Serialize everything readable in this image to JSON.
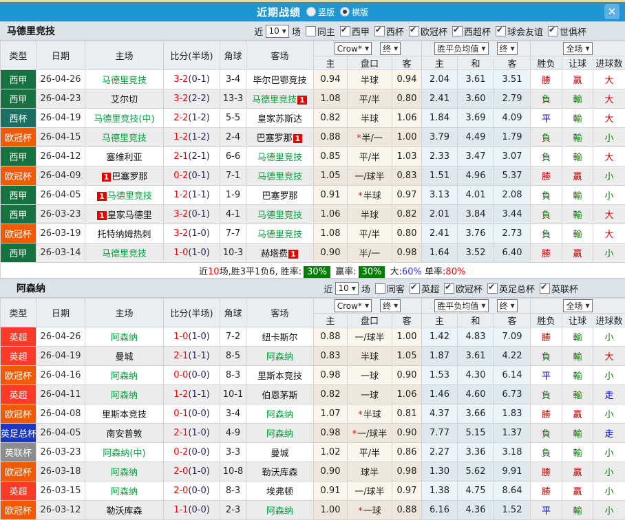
{
  "titlebar": {
    "title": "近期战绩",
    "vertical_label": "竖版",
    "horizontal_label": "横版"
  },
  "card_label": "1",
  "league_colors": {
    "西甲": "#177241",
    "西杯": "#1c6f63",
    "欧冠杯": "#f25a02",
    "英超": "#fb3a28",
    "英足总杯": "#1c38c0",
    "英联杯": "#8d8d8d"
  },
  "result_colors": {
    "r": "#cc0000",
    "g": "#008000",
    "b": "#0000cc"
  },
  "headers": {
    "type": "类型",
    "date": "日期",
    "home": "主场",
    "score": "比分(半场)",
    "corner": "角球",
    "away": "客场",
    "crown_home": "主",
    "crown_handicap": "盘口",
    "crown_away": "客",
    "euro_home": "主",
    "euro_draw": "和",
    "euro_away": "客",
    "res_wdl": "胜负",
    "res_handicap": "让球",
    "res_goals": "进球数"
  },
  "tables": [
    {
      "team": "马德里竞技",
      "filters": {
        "near": "近",
        "count": "10",
        "games": "场",
        "same": "同主",
        "leagues": [
          "西甲",
          "西杯",
          "欧冠杯",
          "西超杯",
          "球会友谊",
          "世俱杯"
        ]
      },
      "dropdowns": {
        "book": "Crow*",
        "final_a": "终",
        "avg": "胜平负均值",
        "final_b": "终",
        "scope": "全场"
      },
      "rows": [
        {
          "type": "西甲",
          "date": "26-04-26",
          "home": "马德里竞技",
          "home_hl": true,
          "score": "3-2",
          "half": "(0-1)",
          "corner": "3-4",
          "away": "毕尔巴鄂竞技",
          "c1": "0.94",
          "hc": "半球",
          "c2": "0.94",
          "e1": "2.04",
          "e2": "3.61",
          "e3": "3.51",
          "r1": "勝",
          "r1c": "r",
          "r2": "贏",
          "r2c": "r",
          "r3": "大",
          "r3c": "r"
        },
        {
          "type": "西甲",
          "date": "26-04-23",
          "home": "艾尔切",
          "score": "3-2",
          "half": "(2-2)",
          "corner": "13-3",
          "away": "马德里竞技",
          "away_hl": true,
          "away_card": "trail",
          "c1": "1.08",
          "hc": "平/半",
          "c2": "0.80",
          "e1": "2.41",
          "e2": "3.60",
          "e3": "2.79",
          "r1": "負",
          "r1c": "g",
          "r2": "輸",
          "r2c": "g",
          "r3": "大",
          "r3c": "r"
        },
        {
          "type": "西杯",
          "date": "26-04-19",
          "home": "马德里竞技(中)",
          "home_hl": true,
          "score": "2-2",
          "half": "(1-2)",
          "corner": "5-5",
          "away": "皇家苏斯达",
          "c1": "0.82",
          "hc": "半球",
          "c2": "1.06",
          "e1": "1.84",
          "e2": "3.69",
          "e3": "4.09",
          "r1": "平",
          "r1c": "b",
          "r2": "輸",
          "r2c": "g",
          "r3": "大",
          "r3c": "r"
        },
        {
          "type": "欧冠杯",
          "date": "26-04-15",
          "home": "马德里竞技",
          "home_hl": true,
          "score": "1-2",
          "half": "(1-2)",
          "corner": "2-4",
          "away": "巴塞罗那",
          "away_card": "trail",
          "c1": "0.88",
          "hc": "半/一",
          "hc_star": true,
          "c2": "1.00",
          "e1": "3.79",
          "e2": "4.49",
          "e3": "1.79",
          "r1": "負",
          "r1c": "g",
          "r2": "輸",
          "r2c": "g",
          "r3": "小",
          "r3c": "g"
        },
        {
          "type": "西甲",
          "date": "26-04-12",
          "home": "塞维利亚",
          "score": "2-1",
          "half": "(2-1)",
          "corner": "6-6",
          "away": "马德里竞技",
          "away_hl": true,
          "c1": "0.85",
          "hc": "平/半",
          "c2": "1.03",
          "e1": "2.33",
          "e2": "3.47",
          "e3": "3.07",
          "r1": "負",
          "r1c": "g",
          "r2": "輸",
          "r2c": "g",
          "r3": "大",
          "r3c": "r"
        },
        {
          "type": "欧冠杯",
          "date": "26-04-09",
          "home": "巴塞罗那",
          "home_card": "lead",
          "score": "0-2",
          "half": "(0-1)",
          "corner": "7-1",
          "away": "马德里竞技",
          "away_hl": true,
          "c1": "1.05",
          "hc": "一/球半",
          "c2": "0.83",
          "e1": "1.51",
          "e2": "4.96",
          "e3": "5.37",
          "r1": "勝",
          "r1c": "r",
          "r2": "贏",
          "r2c": "r",
          "r3": "小",
          "r3c": "g"
        },
        {
          "type": "西甲",
          "date": "26-04-05",
          "home": "马德里竞技",
          "home_hl": true,
          "home_card": "lead",
          "score": "1-2",
          "half": "(1-1)",
          "corner": "1-9",
          "away": "巴塞罗那",
          "c1": "0.91",
          "hc": "半球",
          "hc_star": true,
          "c2": "0.97",
          "e1": "3.13",
          "e2": "4.01",
          "e3": "2.08",
          "r1": "負",
          "r1c": "g",
          "r2": "輸",
          "r2c": "g",
          "r3": "小",
          "r3c": "g"
        },
        {
          "type": "西甲",
          "date": "26-03-23",
          "home": "皇家马德里",
          "home_card": "lead",
          "score": "3-2",
          "half": "(0-1)",
          "corner": "4-1",
          "away": "马德里竞技",
          "away_hl": true,
          "c1": "1.06",
          "hc": "半球",
          "c2": "0.82",
          "e1": "2.01",
          "e2": "3.84",
          "e3": "3.44",
          "r1": "負",
          "r1c": "g",
          "r2": "輸",
          "r2c": "g",
          "r3": "大",
          "r3c": "r"
        },
        {
          "type": "欧冠杯",
          "date": "26-03-19",
          "home": "托特纳姆热刺",
          "score": "3-2",
          "half": "(1-0)",
          "corner": "7-7",
          "away": "马德里竞技",
          "away_hl": true,
          "c1": "1.08",
          "hc": "平/半",
          "c2": "0.80",
          "e1": "2.41",
          "e2": "3.76",
          "e3": "2.73",
          "r1": "負",
          "r1c": "g",
          "r2": "輸",
          "r2c": "g",
          "r3": "大",
          "r3c": "r"
        },
        {
          "type": "西甲",
          "date": "26-03-14",
          "home": "马德里竞技",
          "home_hl": true,
          "score": "1-0",
          "half": "(1-0)",
          "corner": "10-3",
          "away": "赫塔费",
          "away_card": "trail",
          "c1": "0.90",
          "hc": "半/一",
          "c2": "0.98",
          "e1": "1.64",
          "e2": "3.52",
          "e3": "6.40",
          "r1": "勝",
          "r1c": "r",
          "r2": "贏",
          "r2c": "r",
          "r3": "小",
          "r3c": "g"
        }
      ],
      "summary": [
        {
          "t": "近",
          "c": "k"
        },
        {
          "t": "10",
          "c": "red"
        },
        {
          "t": "场,胜3平1负6, 胜率:",
          "c": "k"
        },
        {
          "t": "30%",
          "c": "chip"
        },
        {
          "t": " 赢率:",
          "c": "k"
        },
        {
          "t": "30%",
          "c": "chip"
        },
        {
          "t": " 大:",
          "c": "k"
        },
        {
          "t": "60%",
          "c": "blue"
        },
        {
          "t": " 单率:",
          "c": "k"
        },
        {
          "t": "80%",
          "c": "red"
        }
      ]
    },
    {
      "team": "阿森纳",
      "filters": {
        "near": "近",
        "count": "10",
        "games": "场",
        "same": "同客",
        "leagues": [
          "英超",
          "欧冠杯",
          "英足总杯",
          "英联杯"
        ]
      },
      "dropdowns": {
        "book": "Crow*",
        "final_a": "终",
        "avg": "胜平负均值",
        "final_b": "终",
        "scope": "全场"
      },
      "rows": [
        {
          "type": "英超",
          "date": "26-04-26",
          "home": "阿森纳",
          "home_hl": true,
          "score": "1-0",
          "half": "(1-0)",
          "corner": "7-2",
          "away": "纽卡斯尔",
          "c1": "0.88",
          "hc": "一/球半",
          "c2": "1.00",
          "e1": "1.42",
          "e2": "4.83",
          "e3": "7.09",
          "r1": "勝",
          "r1c": "r",
          "r2": "輸",
          "r2c": "g",
          "r3": "小",
          "r3c": "g"
        },
        {
          "type": "英超",
          "date": "26-04-19",
          "home": "曼城",
          "score": "2-1",
          "half": "(1-1)",
          "corner": "8-5",
          "away": "阿森纳",
          "away_hl": true,
          "c1": "0.83",
          "hc": "半球",
          "c2": "1.05",
          "e1": "1.87",
          "e2": "3.61",
          "e3": "4.22",
          "r1": "負",
          "r1c": "g",
          "r2": "輸",
          "r2c": "g",
          "r3": "大",
          "r3c": "r"
        },
        {
          "type": "欧冠杯",
          "date": "26-04-16",
          "home": "阿森纳",
          "home_hl": true,
          "score": "0-0",
          "half": "(0-0)",
          "corner": "8-3",
          "away": "里斯本竞技",
          "c1": "0.98",
          "hc": "一球",
          "c2": "0.90",
          "e1": "1.53",
          "e2": "4.30",
          "e3": "6.14",
          "r1": "平",
          "r1c": "b",
          "r2": "輸",
          "r2c": "g",
          "r3": "小",
          "r3c": "g"
        },
        {
          "type": "英超",
          "date": "26-04-11",
          "home": "阿森纳",
          "home_hl": true,
          "score": "1-2",
          "half": "(1-1)",
          "corner": "10-1",
          "away": "伯恩茅斯",
          "c1": "0.82",
          "hc": "一球",
          "c2": "1.06",
          "e1": "1.46",
          "e2": "4.60",
          "e3": "6.73",
          "r1": "負",
          "r1c": "g",
          "r2": "輸",
          "r2c": "g",
          "r3": "走",
          "r3c": "b"
        },
        {
          "type": "欧冠杯",
          "date": "26-04-08",
          "home": "里斯本竞技",
          "score": "0-1",
          "half": "(0-0)",
          "corner": "3-4",
          "away": "阿森纳",
          "away_hl": true,
          "c1": "1.07",
          "hc": "半球",
          "hc_star": true,
          "c2": "0.81",
          "e1": "4.37",
          "e2": "3.66",
          "e3": "1.83",
          "r1": "勝",
          "r1c": "r",
          "r2": "贏",
          "r2c": "r",
          "r3": "小",
          "r3c": "g"
        },
        {
          "type": "英足总杯",
          "date": "26-04-05",
          "home": "南安普敦",
          "score": "2-1",
          "half": "(1-0)",
          "corner": "4-9",
          "away": "阿森纳",
          "away_hl": true,
          "c1": "0.98",
          "hc": "一/球半",
          "hc_star": true,
          "c2": "0.90",
          "e1": "7.77",
          "e2": "5.15",
          "e3": "1.37",
          "r1": "負",
          "r1c": "g",
          "r2": "輸",
          "r2c": "g",
          "r3": "走",
          "r3c": "b"
        },
        {
          "type": "英联杯",
          "date": "26-03-23",
          "home": "阿森纳(中)",
          "home_hl": true,
          "score": "0-2",
          "half": "(0-0)",
          "corner": "3-3",
          "away": "曼城",
          "c1": "1.02",
          "hc": "平/半",
          "c2": "0.86",
          "e1": "2.27",
          "e2": "3.36",
          "e3": "3.18",
          "r1": "負",
          "r1c": "g",
          "r2": "輸",
          "r2c": "g",
          "r3": "小",
          "r3c": "g"
        },
        {
          "type": "欧冠杯",
          "date": "26-03-18",
          "home": "阿森纳",
          "home_hl": true,
          "score": "2-0",
          "half": "(1-0)",
          "corner": "10-8",
          "away": "勒沃库森",
          "c1": "0.90",
          "hc": "球半",
          "c2": "0.98",
          "e1": "1.30",
          "e2": "5.62",
          "e3": "9.91",
          "r1": "勝",
          "r1c": "r",
          "r2": "贏",
          "r2c": "r",
          "r3": "小",
          "r3c": "g"
        },
        {
          "type": "英超",
          "date": "26-03-15",
          "home": "阿森纳",
          "home_hl": true,
          "score": "2-0",
          "half": "(0-0)",
          "corner": "8-3",
          "away": "埃弗顿",
          "c1": "0.91",
          "hc": "一/球半",
          "c2": "0.97",
          "e1": "1.38",
          "e2": "4.75",
          "e3": "8.64",
          "r1": "勝",
          "r1c": "r",
          "r2": "贏",
          "r2c": "r",
          "r3": "小",
          "r3c": "g"
        },
        {
          "type": "欧冠杯",
          "date": "26-03-12",
          "home": "勒沃库森",
          "score": "1-1",
          "half": "(0-0)",
          "corner": "2-3",
          "away": "阿森纳",
          "away_hl": true,
          "c1": "1.00",
          "hc": "一球",
          "hc_star": true,
          "c2": "0.88",
          "e1": "6.16",
          "e2": "4.36",
          "e3": "1.52",
          "r1": "平",
          "r1c": "b",
          "r2": "輸",
          "r2c": "g",
          "r3": "小",
          "r3c": "g"
        }
      ]
    }
  ]
}
